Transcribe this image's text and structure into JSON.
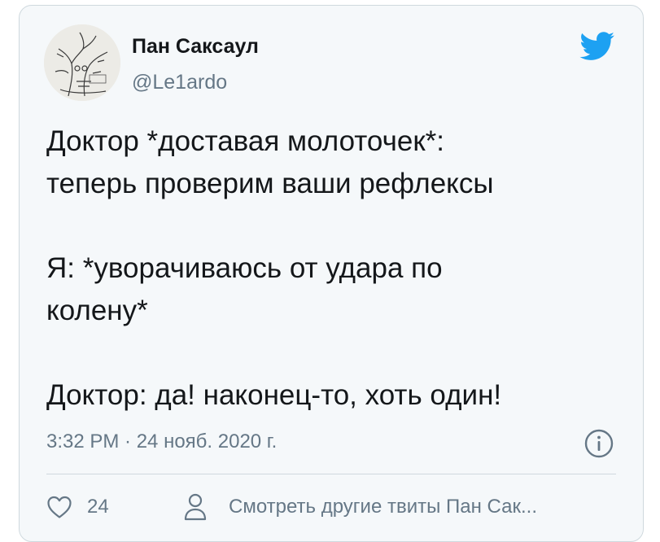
{
  "tweet": {
    "author_name": "Пан Саксаул",
    "author_handle": "@Le1ardo",
    "text": "Доктор *доставая молоточек*:\nтеперь проверим ваши рефлексы\n\nЯ: *уворачиваюсь от удара по\nколену*\n\nДоктор: да! наконец-то, хоть один!",
    "timestamp": "3:32 PM · 24 нояб. 2020 г.",
    "like_count": "24",
    "view_profile_label": "Смотреть другие твиты Пан Сак..."
  },
  "icons": {
    "brand": "twitter-bird-icon",
    "info": "info-icon",
    "like": "heart-icon",
    "profile": "person-icon"
  },
  "colors": {
    "brand": "#1da1f2",
    "card_background": "#f5f8fa",
    "secondary_text": "#657786"
  }
}
